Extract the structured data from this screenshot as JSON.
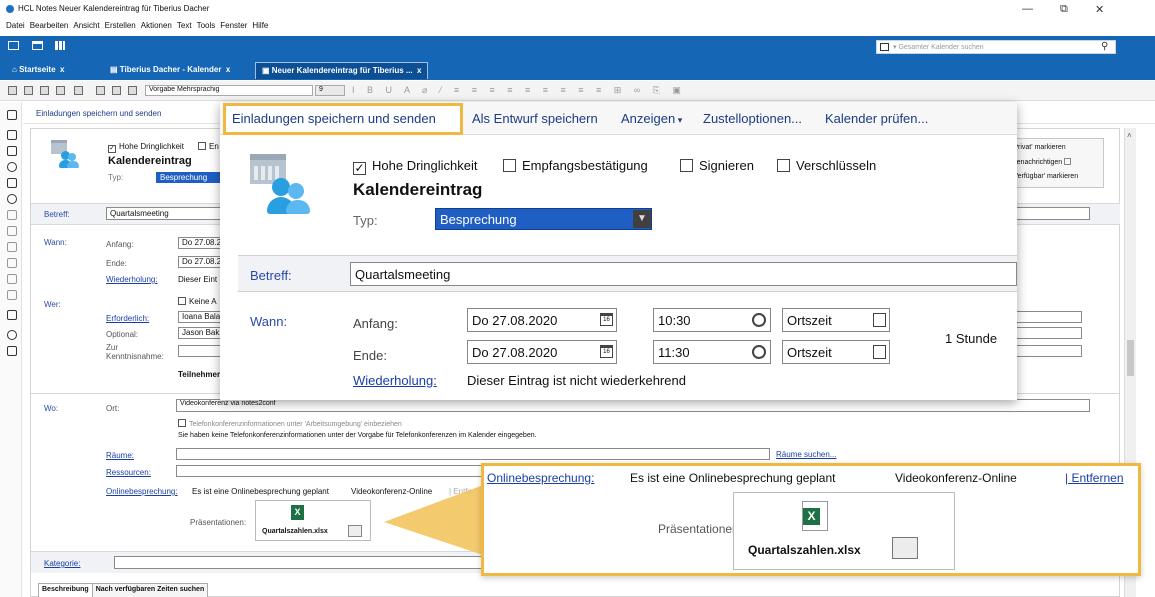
{
  "window": {
    "title": "HCL Notes Neuer Kalendereintrag für Tiberius Dacher",
    "controls": [
      "—",
      "⧉",
      "✕"
    ]
  },
  "menubar": [
    "Datei",
    "Bearbeiten",
    "Ansicht",
    "Erstellen",
    "Aktionen",
    "Text",
    "Tools",
    "Fenster",
    "Hilfe"
  ],
  "search": {
    "placeholder": "Gesamter Kalender suchen"
  },
  "tabs": [
    {
      "label": "Startseite",
      "close": "x"
    },
    {
      "label": "Tiberius Dacher - Kalender",
      "close": "x"
    },
    {
      "label": "Neuer Kalendereintrag für Tiberius ...",
      "close": "x"
    }
  ],
  "toolbar": {
    "style_select": "Vorgabe Mehrsprachig",
    "size_select": "9"
  },
  "actionbar": {
    "save_send": "Einladungen speichern und senden",
    "draft": "Als Entwurf speichern",
    "show": "Anzeigen",
    "delivery": "Zustelloptionen...",
    "check": "Kalender prüfen..."
  },
  "right_panel": {
    "private": "'Privat' markieren",
    "notify": "Benachrichtigen",
    "available": "'Verfügbar' markieren"
  },
  "form": {
    "urgent": "Hohe Dringlichkeit",
    "receipt": "Empfangsbestätigung",
    "sign": "Signieren",
    "encrypt": "Verschlüsseln",
    "title": "Kalendereintrag",
    "type_label": "Typ:",
    "type_value": "Besprechung",
    "subject_label": "Betreff:",
    "subject_value": "Quartalsmeeting",
    "when_label": "Wann:",
    "start_label": "Anfang:",
    "start_date": "Do 27.08.2020",
    "start_time": "10:30",
    "end_label": "Ende:",
    "end_date": "Do 27.08.2020",
    "end_time": "11:30",
    "timezone": "Ortszeit",
    "duration": "1 Stunde",
    "repeat_label": "Wiederholung:",
    "repeat_value": "Dieser Eintrag ist nicht wiederkehrend",
    "who_label": "Wer:",
    "no_attendees": "Keine A",
    "required_label": "Erforderlich:",
    "required_value": "Ioana Bala",
    "optional_label": "Optional:",
    "optional_value": "Jason Bak",
    "fyi_label": "Zur Kenntnisnahme:",
    "participants": "Teilnehmer",
    "where_label": "Wo:",
    "location_label": "Ort:",
    "location_value": "Videokonferenz via notes2conf",
    "phone_conf_include": "Telefonkonferenzinformationen unter 'Arbeitsumgebung' einbeziehen",
    "phone_conf_none": "Sie haben keine Telefonkonferenzinformationen unter der Vorgabe für Telefonkonferenzen im Kalender eingegeben.",
    "rooms_label": "Räume:",
    "rooms_search": "Räume suchen...",
    "resources_label": "Ressourcen:",
    "online_label": "Onlinebesprechung:",
    "online_value": "Es ist eine Onlinebesprechung geplant",
    "online_type": "Videokonferenz-Online",
    "remove": "| Entfernen",
    "presentations_label": "Präsentationen:",
    "attachment_name": "Quartalszahlen.xlsx",
    "category_label": "Kategorie:"
  },
  "bottom_tabs": [
    "Beschreibung",
    "Nach verfügbaren Zeiten suchen"
  ]
}
